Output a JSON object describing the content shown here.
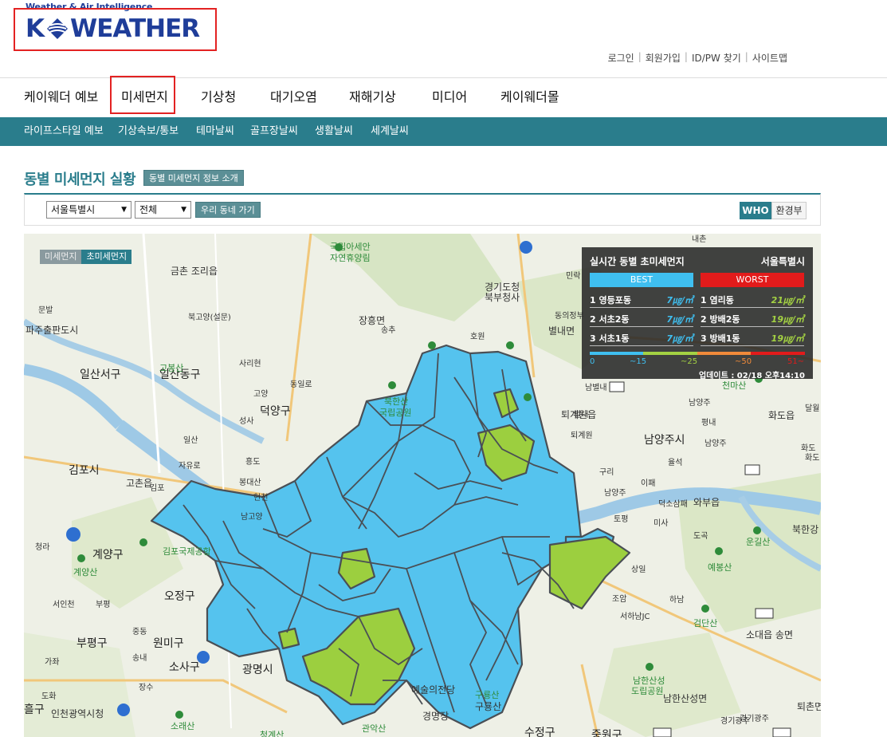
{
  "header": {
    "tagline": "Weather & Air Intelligence",
    "logo_left": "K",
    "logo_right": "WEATHER",
    "utility": [
      "로그인",
      "회원가입",
      "ID/PW 찾기",
      "사이트맵"
    ],
    "utility_sep": "|"
  },
  "gnb": {
    "items": [
      "케이웨더 예보",
      "미세먼지",
      "기상청",
      "대기오염",
      "재해기상",
      "미디어",
      "케이웨더몰"
    ],
    "selected": "미세먼지"
  },
  "sub_nav": {
    "items": [
      "라이프스타일 예보",
      "기상속보/통보",
      "테마날씨",
      "골프장날씨",
      "생활날씨",
      "세계날씨"
    ]
  },
  "section": {
    "title": "동별 미세먼지 실황",
    "intro_button": "동별 미세먼지 정보 소개"
  },
  "filters": {
    "region": "서울특별시",
    "district": "전체",
    "go_button": "우리 동네 가기",
    "standard_who": "WHO",
    "standard_moe": "환경부"
  },
  "map": {
    "toggle": [
      "미세먼지",
      "초미세먼지"
    ],
    "toggle_selected": "초미세먼지",
    "labels": [
      {
        "t": "국립아세안",
        "c": "green"
      },
      {
        "t": "자연휴양림",
        "c": "green"
      },
      {
        "t": "경기도청",
        "c": ""
      },
      {
        "t": "북부청사",
        "c": ""
      },
      {
        "t": "금촌 조리읍",
        "c": ""
      },
      {
        "t": "문발",
        "c": "ic"
      },
      {
        "t": "북고양(설문)",
        "c": "ic"
      },
      {
        "t": "파주출판도시",
        "c": ""
      },
      {
        "t": "장흥면",
        "c": ""
      },
      {
        "t": "송추",
        "c": "ic"
      },
      {
        "t": "호원",
        "c": "ic"
      },
      {
        "t": "별내면",
        "c": ""
      },
      {
        "t": "일산서구",
        "c": "big"
      },
      {
        "t": "일산동구",
        "c": "big"
      },
      {
        "t": "고봉산",
        "c": "green"
      },
      {
        "t": "사리현",
        "c": "ic"
      },
      {
        "t": "동일로",
        "c": "ic"
      },
      {
        "t": "고양",
        "c": "ic"
      },
      {
        "t": "덕양구",
        "c": "big"
      },
      {
        "t": "북한산",
        "c": "green"
      },
      {
        "t": "국립공원",
        "c": "green"
      },
      {
        "t": "퇴계원읍",
        "c": ""
      },
      {
        "t": "남양주시",
        "c": "big"
      },
      {
        "t": "김포시",
        "c": "big"
      },
      {
        "t": "고촌읍",
        "c": ""
      },
      {
        "t": "자유로",
        "c": "ic"
      },
      {
        "t": "일산",
        "c": "ic"
      },
      {
        "t": "성사",
        "c": "ic"
      },
      {
        "t": "흥도",
        "c": "ic"
      },
      {
        "t": "봉대산",
        "c": "ic"
      },
      {
        "t": "김포",
        "c": "ic"
      },
      {
        "t": "현천",
        "c": "ic"
      },
      {
        "t": "남고양",
        "c": "ic"
      },
      {
        "t": "계양구",
        "c": "big"
      },
      {
        "t": "계양산",
        "c": "green"
      },
      {
        "t": "김포국제공항",
        "c": "green"
      },
      {
        "t": "오정구",
        "c": "big"
      },
      {
        "t": "서인천",
        "c": "ic"
      },
      {
        "t": "부평",
        "c": "ic"
      },
      {
        "t": "부평구",
        "c": "big"
      },
      {
        "t": "원미구",
        "c": "big"
      },
      {
        "t": "소사구",
        "c": "big"
      },
      {
        "t": "광명시",
        "c": "big"
      },
      {
        "t": "인천광역시청",
        "c": ""
      },
      {
        "t": "소래산",
        "c": "green"
      },
      {
        "t": "관악산",
        "c": "green"
      },
      {
        "t": "예술의전당",
        "c": ""
      },
      {
        "t": "구룡산",
        "c": "green"
      },
      {
        "t": "청계산",
        "c": "green"
      },
      {
        "t": "수정구",
        "c": "big"
      },
      {
        "t": "중원구",
        "c": "big"
      },
      {
        "t": "하남",
        "c": "ic"
      },
      {
        "t": "서하남JC",
        "c": "ic"
      },
      {
        "t": "검단산",
        "c": "green"
      },
      {
        "t": "소대읍 송면",
        "c": ""
      },
      {
        "t": "남한산성",
        "c": "green"
      },
      {
        "t": "도립공원",
        "c": "green"
      },
      {
        "t": "남한산성면",
        "c": ""
      },
      {
        "t": "경기광주",
        "c": "ic"
      },
      {
        "t": "퇴촌면",
        "c": ""
      },
      {
        "t": "덕소삼패",
        "c": "ic"
      },
      {
        "t": "와부읍",
        "c": ""
      },
      {
        "t": "예봉산",
        "c": "green"
      },
      {
        "t": "운길산",
        "c": "green"
      },
      {
        "t": "북한강",
        "c": ""
      },
      {
        "t": "화도읍",
        "c": ""
      },
      {
        "t": "천마산",
        "c": "green"
      },
      {
        "t": "남양주",
        "c": "ic"
      },
      {
        "t": "평내",
        "c": "ic"
      },
      {
        "t": "화도",
        "c": "ic"
      },
      {
        "t": "구리",
        "c": "ic"
      },
      {
        "t": "남양주",
        "c": "ic"
      },
      {
        "t": "토평",
        "c": "ic"
      },
      {
        "t": "미사",
        "c": "ic"
      },
      {
        "t": "도곡",
        "c": "ic"
      },
      {
        "t": "상일",
        "c": "ic"
      },
      {
        "t": "조암",
        "c": "ic"
      },
      {
        "t": "중동",
        "c": "ic"
      },
      {
        "t": "송내",
        "c": "ic"
      },
      {
        "t": "장수",
        "c": "ic"
      },
      {
        "t": "도화",
        "c": "ic"
      },
      {
        "t": "가좌",
        "c": "ic"
      },
      {
        "t": "청라",
        "c": "ic"
      },
      {
        "t": "내촌",
        "c": "ic"
      },
      {
        "t": "민락",
        "c": "ic"
      },
      {
        "t": "동의정부",
        "c": "ic"
      },
      {
        "t": "경기광주",
        "c": "ic"
      },
      {
        "t": "남별내",
        "c": "ic"
      },
      {
        "t": "화도",
        "c": "ic"
      },
      {
        "t": "달월",
        "c": "ic"
      },
      {
        "t": "율석",
        "c": "ic"
      },
      {
        "t": "이패",
        "c": "ic"
      },
      {
        "t": "남양주",
        "c": "ic"
      },
      {
        "t": "퇴계원",
        "c": "ic"
      },
      {
        "t": "별내",
        "c": "ic"
      },
      {
        "t": "경명장",
        "c": ""
      },
      {
        "t": "흘구",
        "c": ""
      },
      {
        "t": "구룡산",
        "c": ""
      }
    ]
  },
  "ranking": {
    "title": "실시간 동별 초미세먼지",
    "region": "서울특별시",
    "best_label": "BEST",
    "worst_label": "WORST",
    "best": [
      {
        "rank": "1",
        "name": "영등포동",
        "value": "7㎍/㎥"
      },
      {
        "rank": "2",
        "name": "서초2동",
        "value": "7㎍/㎥"
      },
      {
        "rank": "3",
        "name": "서초1동",
        "value": "7㎍/㎥"
      }
    ],
    "worst": [
      {
        "rank": "1",
        "name": "염리동",
        "value": "21㎍/㎥"
      },
      {
        "rank": "2",
        "name": "방배2동",
        "value": "19㎍/㎥"
      },
      {
        "rank": "3",
        "name": "방배1동",
        "value": "19㎍/㎥"
      }
    ],
    "scale_labels": [
      "0",
      "~15",
      "~25",
      "~50",
      "51~"
    ],
    "scale_colors": [
      "#3fbff0",
      "#a4d243",
      "#f08a3a",
      "#e21b1b"
    ],
    "update": "업데이트 : 02/18 오후14:10"
  },
  "colors": {
    "accent": "#2a7d8c",
    "brand": "#1f3d99",
    "good": "#55c3ee",
    "moderate": "#9ccf3f",
    "highlight": "#e32222"
  }
}
